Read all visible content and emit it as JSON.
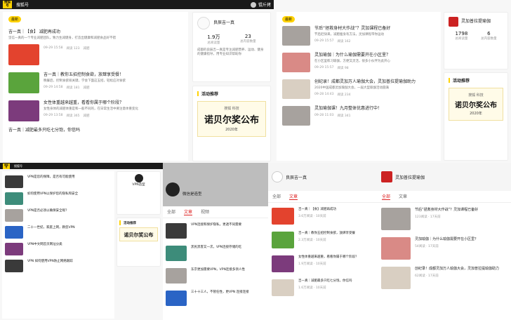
{
  "p1": {
    "bar": {
      "logo": "搜狐\n号",
      "brand": "搜狐号",
      "user": "锟斤拷"
    },
    "tag": "最新",
    "arts": [
      {
        "title": "吉一真｜【食】 减肥再成功",
        "desc": "坚信一真的一个专业减肥团队，致力生减健身，打造出健康和减肥食品好不错",
        "meta": [
          "09-29 15:58",
          "阅读 123",
          "减肥",
          "补充"
        ]
      },
      {
        "title": "吉一真｜教你五招控制食欲，放肆享受餐！",
        "desc": "晚餐后，控制食欲很关键，学会下面这五招，轻松应对食欲",
        "meta": [
          "09-29 14:58",
          "阅读 181",
          "减肥",
          "高血糖",
          "享受"
        ]
      },
      {
        "title": "女性体重越来越重，看看你属于哪个阶段？",
        "desc": "女性身体的减肥体重是和一般不同的，在日常生活中要注意体重变化",
        "meta": [
          "09-29 13:58",
          "阅读 365",
          "减肥",
          "补充"
        ]
      },
      {
        "title": "吉一真｜减肥最多只吃七分饱，你信吗",
        "meta": []
      }
    ],
    "thumbs": [
      "减肥前后",
      "五招控食欲",
      ""
    ],
    "profile": {
      "name": "良辰吉一真",
      "fans_n": "1.9万",
      "fans_l": "总阅读量",
      "follow_n": "23",
      "follow_l": "总内容数量",
      "desc": "成都的良辰吉一真是专注减肥营养、运动、健身的健康指导，用专业知识帮助你",
      "act": "活动推荐"
    },
    "banner": {
      "small": "搜狐 科技",
      "big": "诺贝尔奖公布",
      "yr": "2020年"
    }
  },
  "p2": {
    "tag": "最新",
    "arts": [
      {
        "title": "节后“拯救身材大作战”？灵加课程已备好",
        "desc": "节后赶快来，减肥瘦身有方法，灵加课程带你运动",
        "meta": [
          "09-29 15:57",
          "阅读 162",
          "灵加",
          "课程"
        ]
      },
      {
        "title": "灵加瑜伽｜为什么瑜伽需要开在小区里？",
        "desc": "在小区里练习瑜伽，方便又灵活，很多小伙伴为此开心",
        "meta": [
          "09-29 15:57",
          "阅读 98",
          "瑜伽",
          "健身"
        ]
      },
      {
        "title": "创纪录！成都灵加万人瑜伽大会，灵加普拉提瑜伽助力",
        "desc": "2020中国成都灵加瑜伽大会，一届大型瑜伽活动圆满",
        "meta": [
          "09-28 14:43",
          "阅读 234",
          "瑜伽",
          "大会"
        ]
      },
      {
        "title": "灵加瑜伽课！九月整体优惠进行中！",
        "desc": "",
        "meta": [
          "09-28 11:03",
          "阅读 341",
          "灵加"
        ]
      }
    ],
    "profile": {
      "name": "灵加普拉提瑜伽",
      "fans_n": "1798",
      "fans_l": "总阅读量",
      "follow_n": "6",
      "follow_l": "总内容数量",
      "act": "活动推荐"
    },
    "banner": {
      "small": "搜狐 科技",
      "big": "诺贝尔奖公布",
      "yr": "2020年"
    }
  },
  "p3": {
    "bar": {
      "logo": "搜狐\n号",
      "brand": "搜狐号"
    },
    "arts": [
      "VPN是您的保障，是否有可能使用",
      "如何使用VPN以保护您的隐私和安全",
      "VPN是否必须以确保安全呢？",
      "二十一世纪，家庭上网，教您VPN",
      "VPN中文网首页网址分类",
      "VPN 如何使用VPN防止网络跟踪"
    ],
    "profile": {
      "name": "VPN造型",
      "act": "活动推荐"
    },
    "banner": {
      "big": "诺贝尔奖公布"
    }
  },
  "p4": {
    "name": "微信是造型",
    "tabs": [
      "全部",
      "文章",
      "视频"
    ],
    "arts": [
      "VPN连接和保护隐私，更透不同需要",
      "黑民黑客又一次，VPN连接存储的吃",
      "东京更加需要VPN，VPN连接多领人性",
      "三十十三人，不管任性，更VPN 连接连接"
    ]
  },
  "p5": {
    "name": "良辰吉一真",
    "tabs": [
      "全部",
      "文章"
    ],
    "arts": [
      {
        "title": "吉一真｜【食】减肥再成功",
        "meta": "3.6万阅读 · 10天前"
      },
      {
        "title": "吉一真｜教你五招控制食欲，放肆享受餐",
        "meta": "2.3万阅读 · 10天前"
      },
      {
        "title": "女性体重越来越重，看看你属于哪个阶段？",
        "meta": "1.9万阅读 · 10天前"
      },
      {
        "title": "吉一真｜减肥最多只吃七分饱，你信吗",
        "meta": "1.6万阅读 · 10天前"
      }
    ]
  },
  "p6": {
    "name": "灵加普拉提瑜伽",
    "tabs": [
      "全部",
      "文章"
    ],
    "arts": [
      {
        "title": "节后“拯救身材大作战”？灵加课程已备好",
        "meta": "123阅读 · 17天前"
      },
      {
        "title": "灵加瑜伽｜为什么瑜伽需要开在小区里？",
        "meta": "54阅读 · 17天前"
      },
      {
        "title": "创纪录！成都灵加万人瑜伽大会，灵加普拉提瑜伽助力",
        "meta": "62阅读 · 17天前"
      }
    ]
  }
}
